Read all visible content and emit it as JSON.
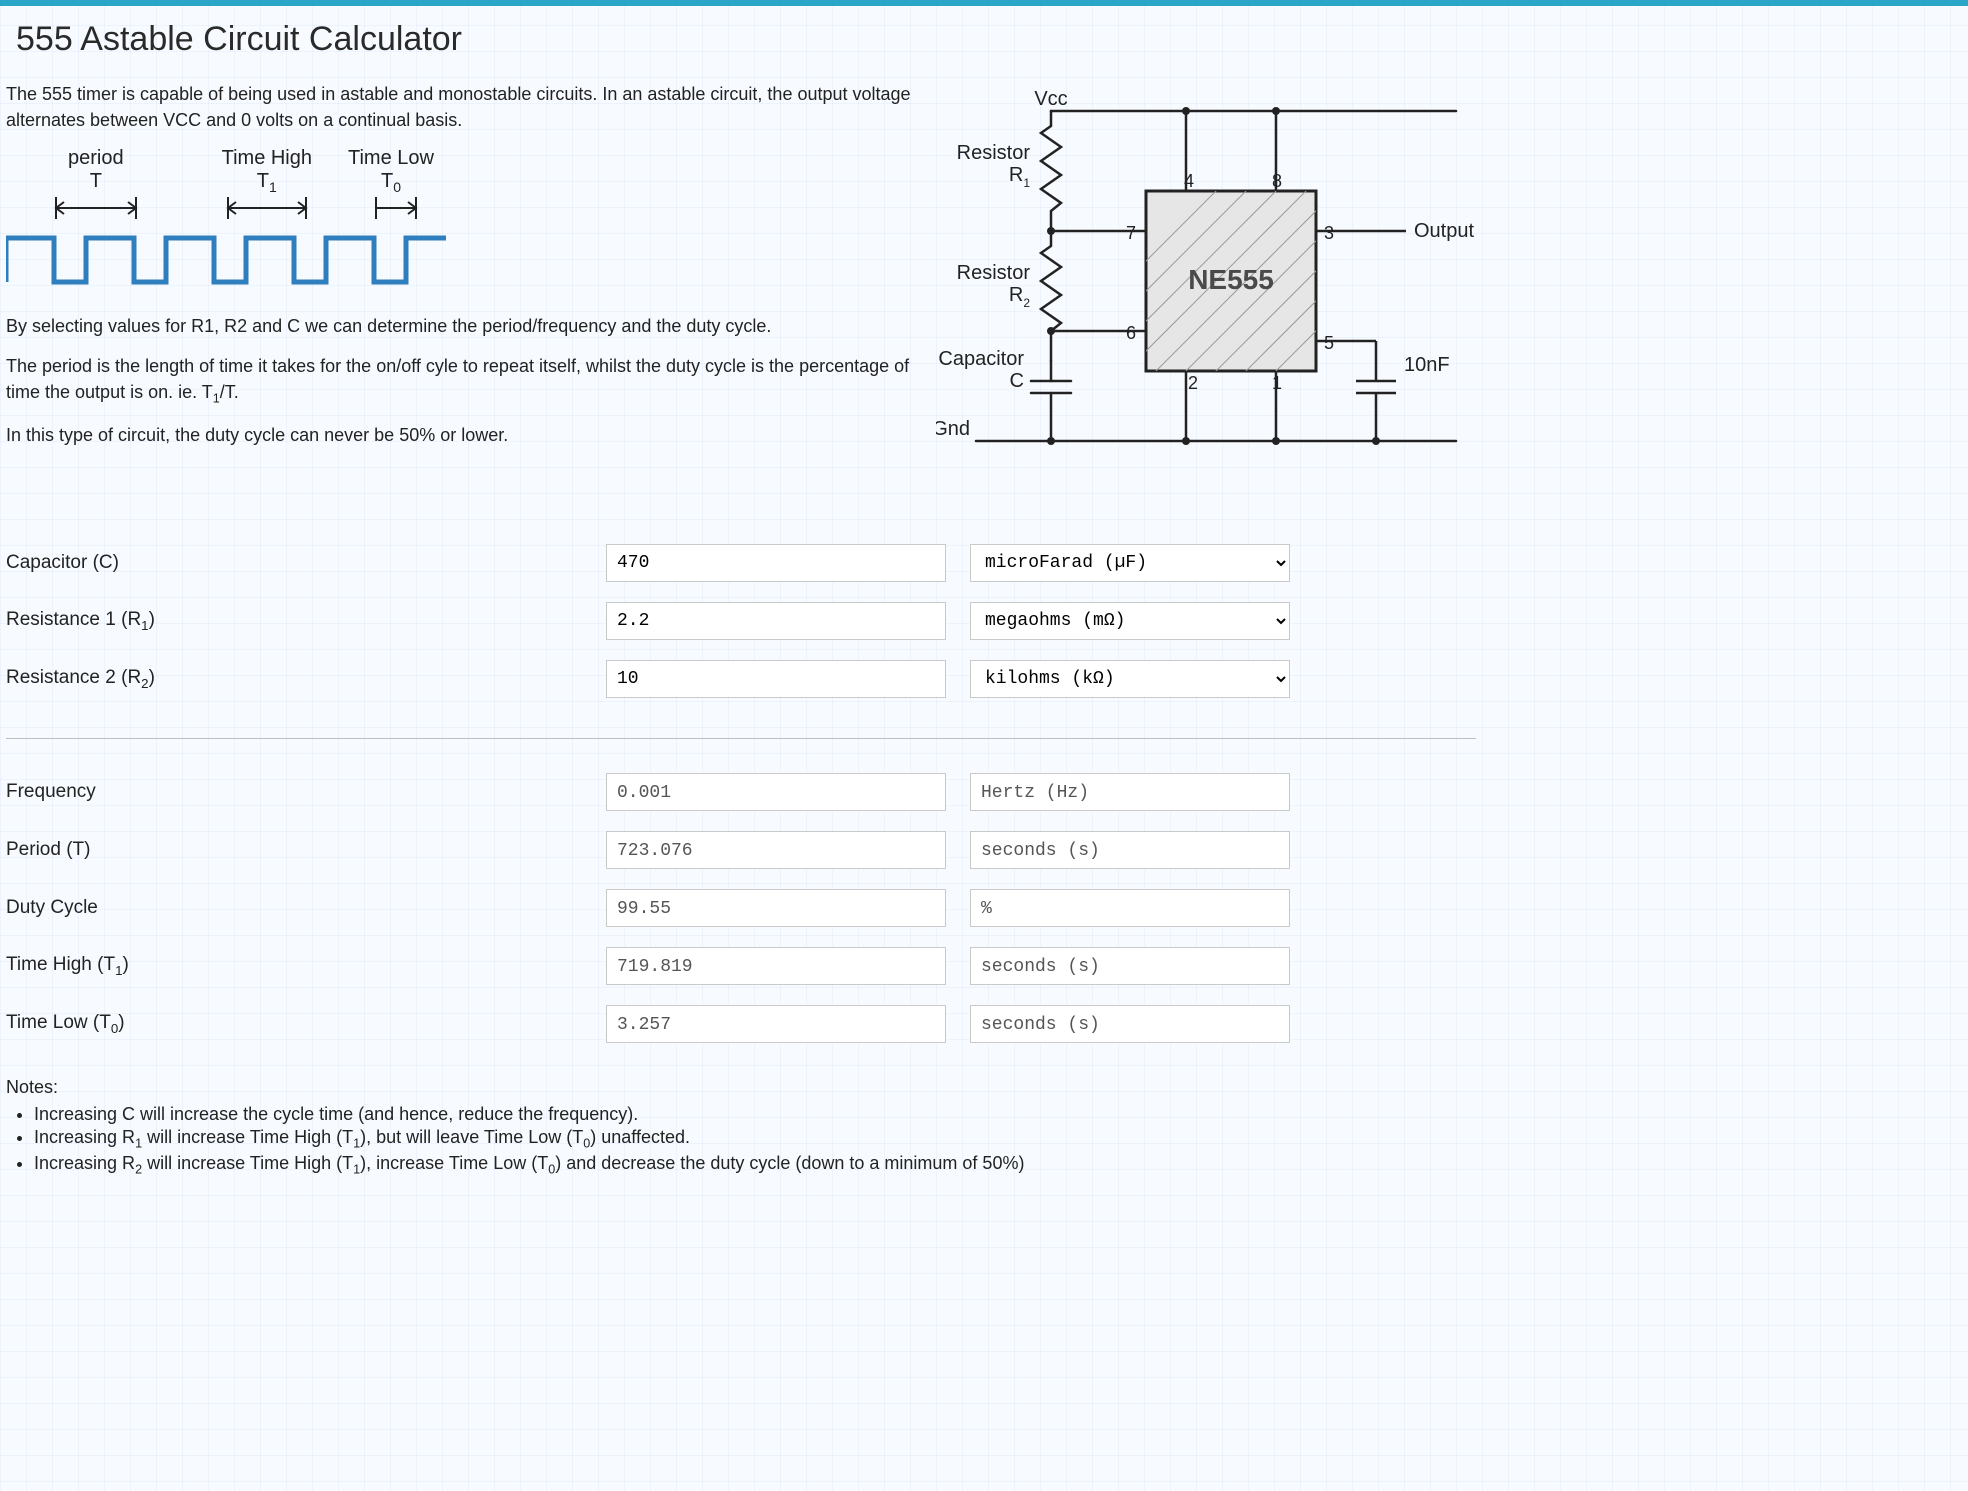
{
  "header": {
    "title": "555 Astable Circuit Calculator"
  },
  "intro": {
    "p1": "The 555 timer is capable of being used in astable and monostable circuits. In an astable circuit, the output voltage alternates between VCC and 0 volts on a continual basis.",
    "p2": "By selecting values for R1, R2 and C we can determine the period/frequency and the duty cycle.",
    "p3part1": "The period is the length of time it takes for the on/off cyle to repeat itself, whilst the duty cycle is the percentage of time the output is on. ie. T",
    "p3sub": "1",
    "p3part2": "/T.",
    "p4": "In this type of circuit, the duty cycle can never be 50% or lower."
  },
  "wave_labels": {
    "period_word": "period",
    "period_sym": "T",
    "thigh_word": "Time High",
    "thigh_sym": "T",
    "thigh_sub": "1",
    "tlow_word": "Time Low",
    "tlow_sym": "T",
    "tlow_sub": "0"
  },
  "diagram": {
    "vcc": "Vcc",
    "r1": "Resistor",
    "r1sym": "R",
    "r1sub": "1",
    "r2": "Resistor",
    "r2sym": "R",
    "r2sub": "2",
    "cap": "Capacitor",
    "capsym": "C",
    "gnd": "Gnd",
    "chip": "NE555",
    "out": "Output",
    "tenNf": "10nF",
    "pin1": "1",
    "pin2": "2",
    "pin3": "3",
    "pin4": "4",
    "pin5": "5",
    "pin6": "6",
    "pin7": "7",
    "pin8": "8"
  },
  "inputs": {
    "cap": {
      "label": "Capacitor (C)",
      "value": "470",
      "unit_selected": "microFarad (µF)"
    },
    "r1": {
      "label_main": "Resistance 1 (R",
      "label_sub": "1",
      "label_end": ")",
      "value": "2.2",
      "unit_selected": "megaohms (mΩ)"
    },
    "r2": {
      "label_main": "Resistance 2 (R",
      "label_sub": "2",
      "label_end": ")",
      "value": "10",
      "unit_selected": "kilohms (kΩ)"
    }
  },
  "outputs": {
    "freq": {
      "label": "Frequency",
      "value": "0.001",
      "unit": "Hertz (Hz)"
    },
    "period": {
      "label": "Period (T)",
      "value": "723.076",
      "unit": "seconds (s)"
    },
    "duty": {
      "label": "Duty Cycle",
      "value": "99.55",
      "unit": "%"
    },
    "th": {
      "label_main": "Time High (T",
      "label_sub": "1",
      "label_end": ")",
      "value": "719.819",
      "unit": "seconds (s)"
    },
    "tl": {
      "label_main": "Time Low (T",
      "label_sub": "0",
      "label_end": ")",
      "value": "3.257",
      "unit": "seconds (s)"
    }
  },
  "notes": {
    "title": "Notes:",
    "n1": "Increasing C will increase the cycle time (and hence, reduce the frequency).",
    "n2a": "Increasing R",
    "n2sub1": "1",
    "n2b": " will increase Time High (T",
    "n2sub2": "1",
    "n2c": "), but will leave Time Low (T",
    "n2sub3": "0",
    "n2d": ") unaffected.",
    "n3a": "Increasing R",
    "n3sub1": "2",
    "n3b": " will increase Time High (T",
    "n3sub2": "1",
    "n3c": "), increase Time Low (T",
    "n3sub3": "0",
    "n3d": ") and decrease the duty cycle (down to a minimum of 50%)"
  }
}
